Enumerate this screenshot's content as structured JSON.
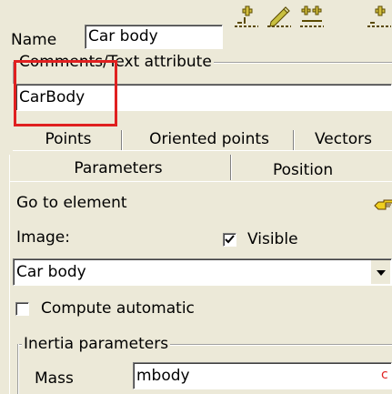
{
  "header": {
    "name_label": "Name",
    "name_value": "Car body",
    "toolbar_icons": [
      "add-element-icon",
      "edit-element-icon",
      "multi-add-icon",
      "add-more-icon"
    ]
  },
  "comments": {
    "group_label": "Comments/Text attribute",
    "value": "CarBody"
  },
  "tabs_row1": [
    "Points",
    "Oriented points",
    "Vectors"
  ],
  "tabs_row2": [
    "Parameters",
    "Position"
  ],
  "parameters": {
    "go_to_label": "Go to element",
    "image_label": "Image:",
    "visible_label": "Visible",
    "visible_checked": true,
    "image_select_value": "Car body",
    "compute_label": "Compute automatic",
    "compute_checked": false,
    "inertia_group_label": "Inertia parameters",
    "mass_label": "Mass",
    "mass_value": "mbody",
    "mass_flag": "c"
  },
  "colors": {
    "highlight_box": "#e02020",
    "window_bg": "#ece9d8"
  }
}
